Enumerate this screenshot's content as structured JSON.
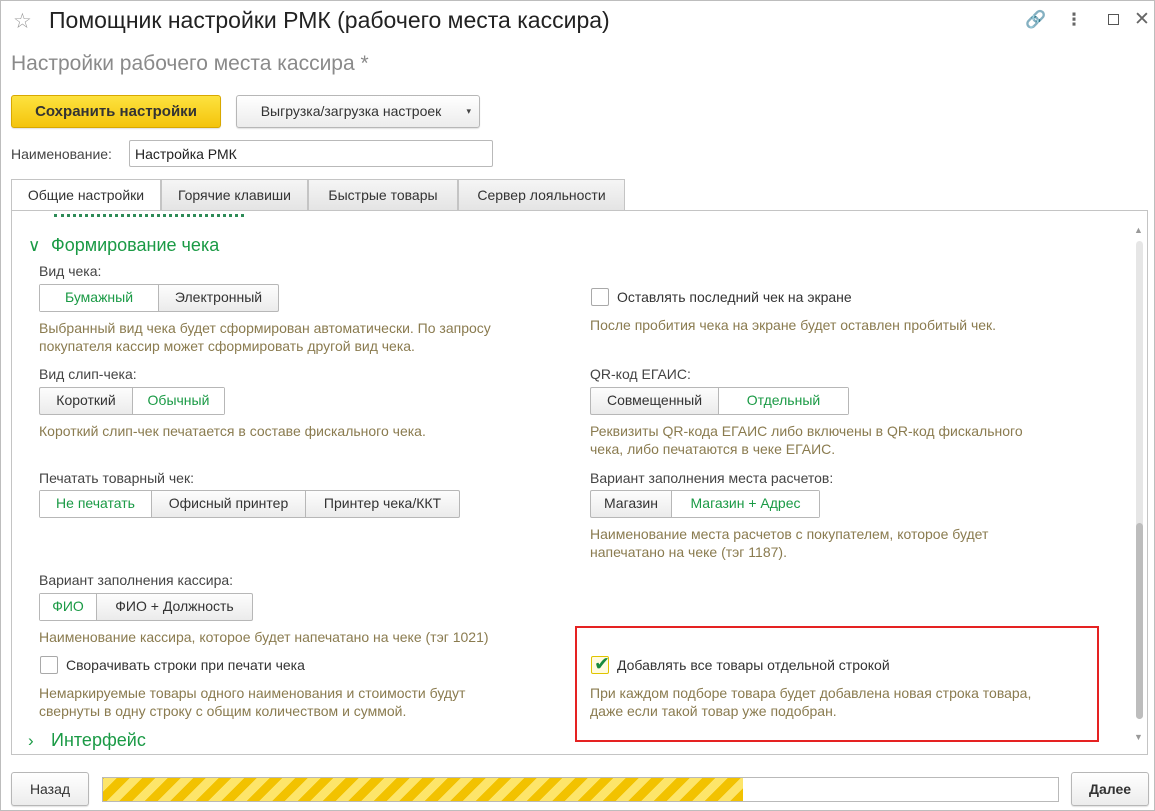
{
  "window": {
    "title": "Помощник настройки РМК (рабочего места кассира)",
    "star_glyph": "☆",
    "link_glyph": "🔗",
    "more_glyph": "⋮",
    "close_glyph": "✕"
  },
  "subtitle": "Настройки рабочего места кассира *",
  "toolbar": {
    "save_label": "Сохранить настройки",
    "io_label": "Выгрузка/загрузка настроек",
    "io_caret": "▾"
  },
  "name": {
    "label": "Наименование:",
    "value": "Настройка РМК"
  },
  "tabs": [
    {
      "label": "Общие настройки"
    },
    {
      "label": "Горячие клавиши"
    },
    {
      "label": "Быстрые товары"
    },
    {
      "label": "Сервер лояльности"
    }
  ],
  "section_receipt": {
    "chevron": "∨",
    "title": "Формирование чека"
  },
  "receipt_type": {
    "label": "Вид чека:",
    "options": [
      "Бумажный",
      "Электронный"
    ],
    "hint_1": "Выбранный вид чека будет сформирован автоматически. По запросу",
    "hint_2": "покупателя кассир может сформировать другой вид чека."
  },
  "keep_last": {
    "label": "Оставлять последний чек на экране",
    "hint": "После пробития чека на экране будет оставлен пробитый чек."
  },
  "slip_type": {
    "label": "Вид слип-чека:",
    "options": [
      "Короткий",
      "Обычный"
    ],
    "hint": "Короткий слип-чек печатается  в составе фискального чека."
  },
  "qr_egais": {
    "label": "QR-код ЕГАИС:",
    "options": [
      "Совмещенный",
      "Отдельный"
    ],
    "hint_1": "Реквизиты QR-кода ЕГАИС либо включены в QR-код фискального",
    "hint_2": "чека, либо печатаются в чеке ЕГАИС."
  },
  "goods_receipt": {
    "label": "Печатать товарный чек:",
    "options": [
      "Не печатать",
      "Офисный принтер",
      "Принтер чека/ККТ"
    ]
  },
  "place": {
    "label": "Вариант заполнения места расчетов:",
    "options": [
      "Магазин",
      "Магазин + Адрес"
    ],
    "hint_1": "Наименование места расчетов с покупателем, которое будет",
    "hint_2": "напечатано на чеке (тэг 1187)."
  },
  "cashier": {
    "label": "Вариант заполнения кассира:",
    "options": [
      "ФИО",
      "ФИО + Должность"
    ],
    "hint": "Наименование кассира, которое будет напечатано на чеке (тэг 1021)"
  },
  "collapse_rows": {
    "label": "Сворачивать строки при печати чека",
    "hint_1": "Немаркируемые товары одного наименования и стоимости будут",
    "hint_2": "свернуты в одну строку с общим количеством и суммой."
  },
  "separate_rows": {
    "label": "Добавлять все товары отдельной строкой",
    "checked": true,
    "check_glyph": "✔",
    "hint_1": "При каждом подборе товара будет добавлена новая строка товара,",
    "hint_2": "даже если такой товар уже подобран."
  },
  "section_interface": {
    "chevron": "›",
    "title": "Интерфейс"
  },
  "scrollbar": {
    "up": "▲",
    "down": "▼"
  },
  "footer": {
    "back_label": "Назад",
    "next_label": "Далее",
    "progress_fraction": 0.67
  }
}
